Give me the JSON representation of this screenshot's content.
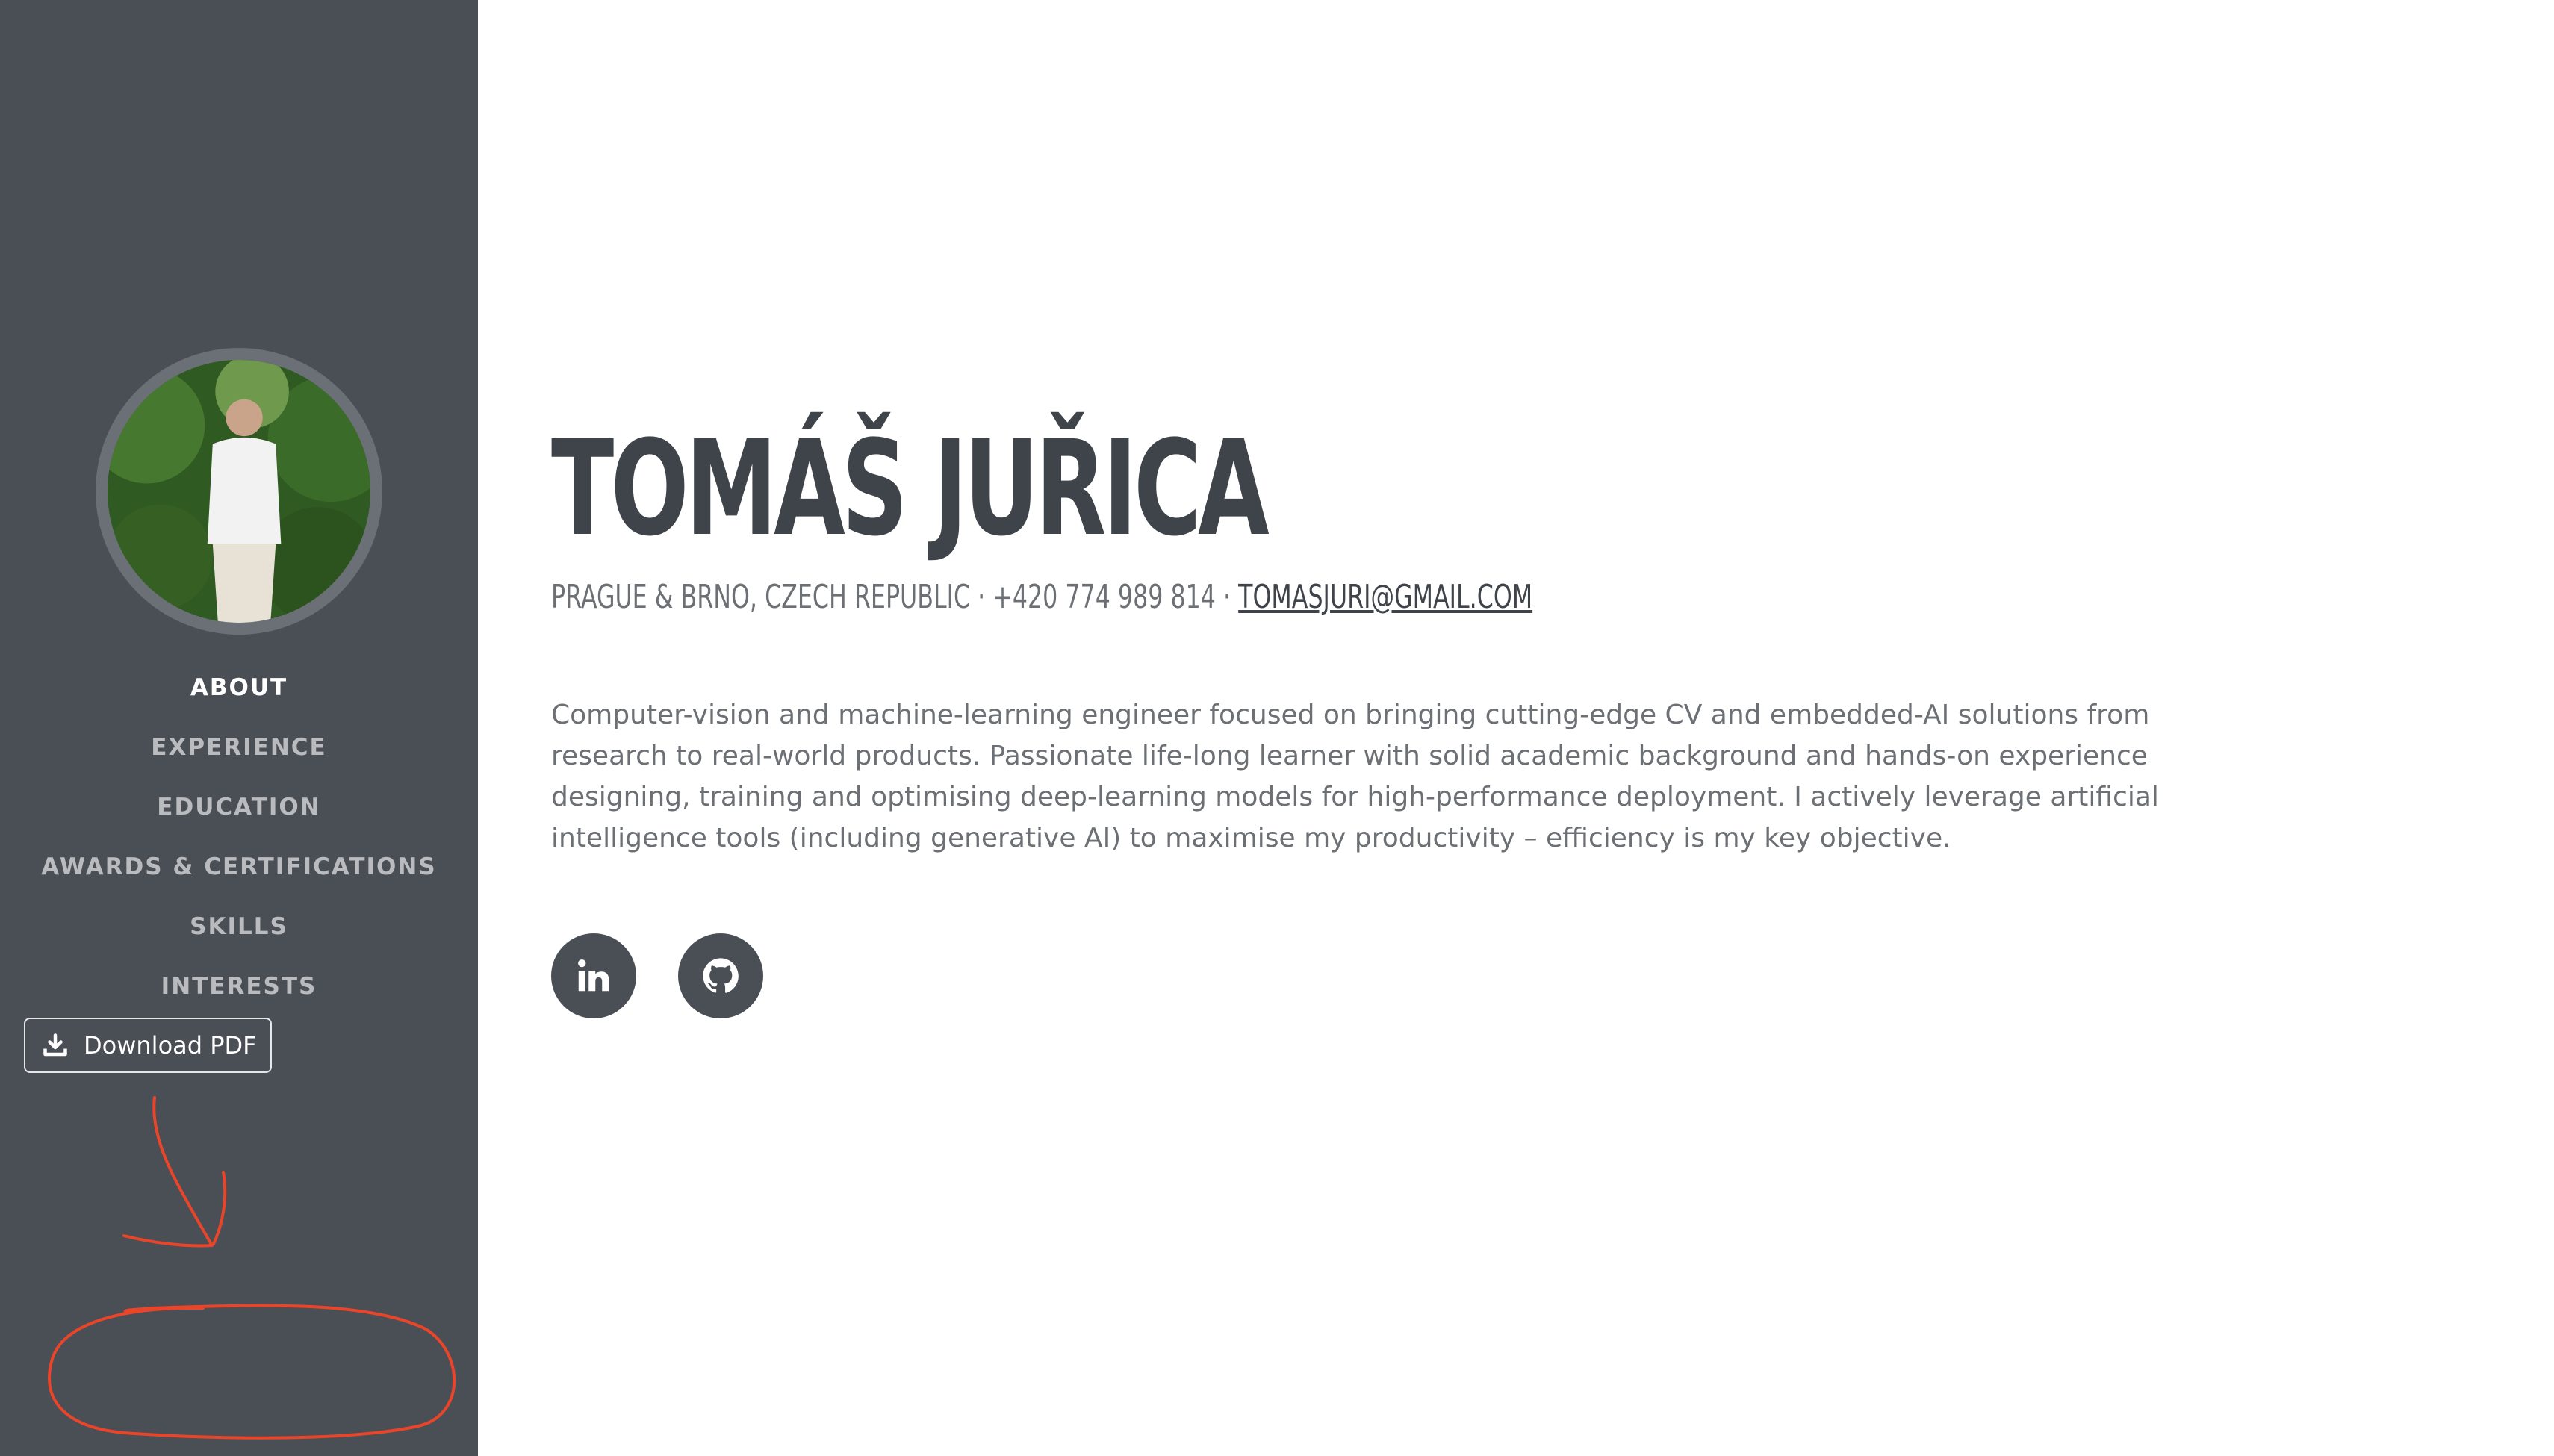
{
  "colors": {
    "sidebar_bg": "#4a4e55",
    "nav_text": "#b9bbbe",
    "nav_active": "#ffffff",
    "heading": "#3f444b",
    "body_text": "#6c7075",
    "annotation": "#e8452a"
  },
  "sidebar": {
    "avatar_alt": "profile photo",
    "nav": [
      {
        "label": "ABOUT",
        "active": true
      },
      {
        "label": "EXPERIENCE"
      },
      {
        "label": "EDUCATION"
      },
      {
        "label": "AWARDS & CERTIFICATIONS"
      },
      {
        "label": "SKILLS"
      },
      {
        "label": "INTERESTS"
      }
    ],
    "download": {
      "label": "Download PDF",
      "icon": "download-icon"
    }
  },
  "main": {
    "name": "TOMÁŠ JUŘICA",
    "location": "PRAGUE & BRNO, CZECH REPUBLIC",
    "separator": " · ",
    "phone": "+420 774 989 814",
    "email": "TOMASJURI@GMAIL.COM",
    "lead": "Computer-vision and machine-learning engineer focused on bringing cutting-edge CV and embedded-AI solutions from research to real-world products. Passionate life-long learner with solid academic background and hands-on experience designing, training and optimising deep-learning models for high-performance deployment. I actively leverage artificial intelligence tools (including generative AI) to maximise my productivity – efficiency is my key objective.",
    "social": [
      {
        "icon": "linkedin-icon"
      },
      {
        "icon": "github-icon"
      }
    ]
  }
}
